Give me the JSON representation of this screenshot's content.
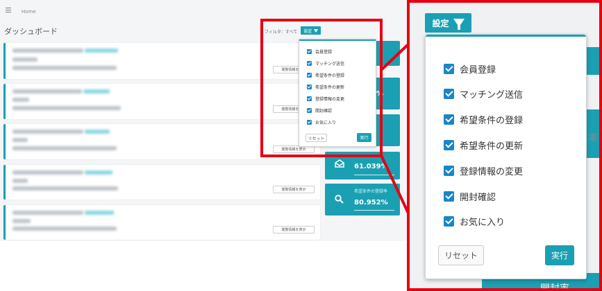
{
  "breadcrumb": {
    "home": "Home"
  },
  "page_title": "ダッシュボード",
  "filter": {
    "label": "フィルタ：すべて",
    "settings_button": "設定"
  },
  "cards": [
    {
      "show_button": "閲覧情報を表示"
    },
    {
      "show_button": "閲覧情報を表示"
    },
    {
      "show_button": "閲覧情報を表示"
    },
    {
      "show_button": "閲覧情報を表示"
    },
    {
      "show_button": "閲覧情報を表示"
    }
  ],
  "stats": [
    {
      "label": "",
      "value": "%"
    },
    {
      "label": "",
      "value": "61.039%"
    },
    {
      "label": "希望条件の登録率",
      "value": "80.952%"
    }
  ],
  "dropdown": {
    "items": [
      {
        "label": "会員登録",
        "checked": true
      },
      {
        "label": "マッチング送信",
        "checked": true
      },
      {
        "label": "希望条件の登録",
        "checked": true
      },
      {
        "label": "希望条件の更新",
        "checked": true
      },
      {
        "label": "登録情報の変更",
        "checked": true
      },
      {
        "label": "開封確認",
        "checked": true
      },
      {
        "label": "お気に入り",
        "checked": true
      }
    ],
    "reset_label": "リセット",
    "run_label": "実行"
  },
  "zoom_background_fragments": {
    "side": "率",
    "bottom": "開封率"
  },
  "colors": {
    "teal": "#1aa0b2",
    "checkbox": "#1a86c8",
    "highlight": "#e60012"
  }
}
